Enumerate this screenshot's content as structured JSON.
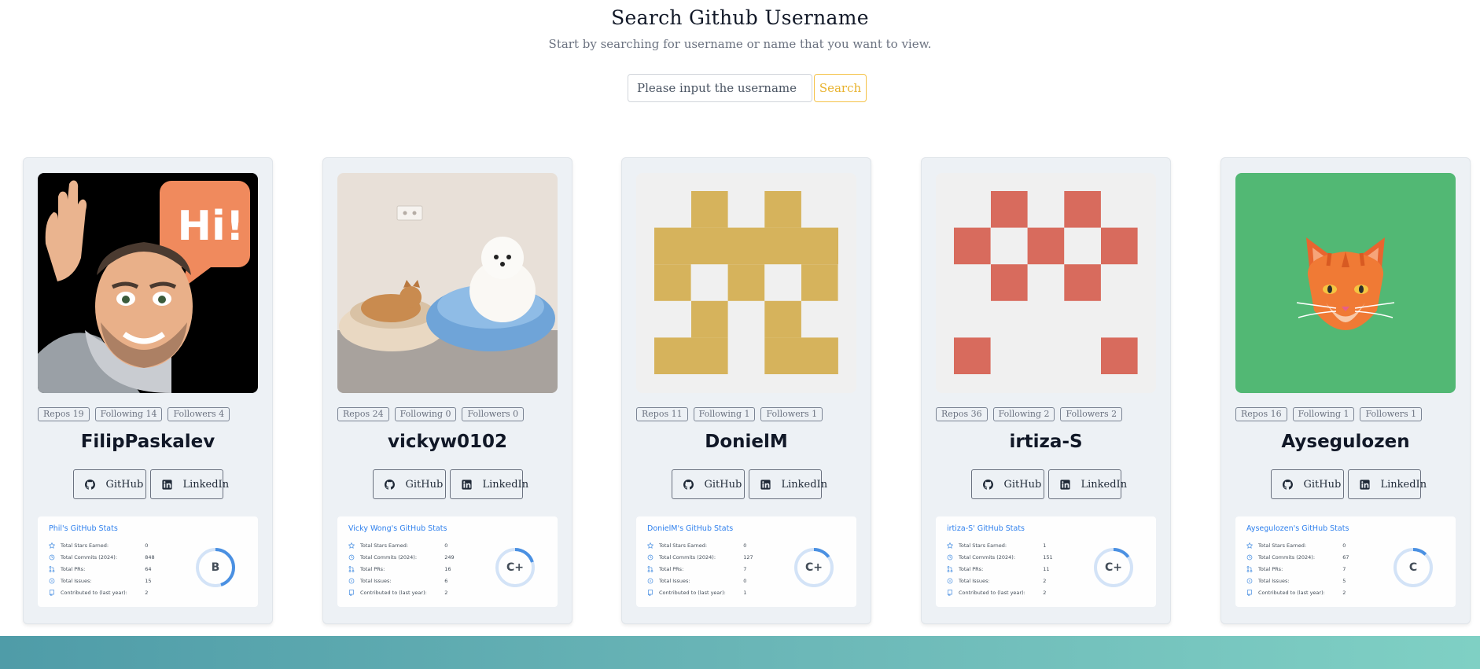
{
  "header": {
    "title": "Search Github Username",
    "subtitle": "Start by searching for username or name that you want to view."
  },
  "search": {
    "placeholder": "Please input the username",
    "button_label": "Search"
  },
  "link_labels": {
    "github": "GitHub",
    "linkedin": "LinkedIn"
  },
  "stat_labels": {
    "stars": "Total Stars Earned:",
    "commits": "Total Commits (2024):",
    "prs": "Total PRs:",
    "issues": "Total Issues:",
    "contributed": "Contributed to (last year):"
  },
  "colors": {
    "accent": "#f5c34a",
    "stats_title": "#2f80ed",
    "ring": "#4a90e2",
    "footer": "#5fb0b0"
  },
  "cards": [
    {
      "username": "FilipPaskalev",
      "repos": "Repos 19",
      "following": "Following 14",
      "followers": "Followers 4",
      "avatar": "memoji-hi-avatar",
      "stats": {
        "title": "Phil's GitHub Stats",
        "stars": "0",
        "commits": "848",
        "prs": "64",
        "issues": "15",
        "contributed": "2",
        "grade": "B",
        "rank_progress": 0.45
      }
    },
    {
      "username": "vickyw0102",
      "repos": "Repos 24",
      "following": "Following 0",
      "followers": "Followers 0",
      "avatar": "cat-and-dog-photo-avatar",
      "stats": {
        "title": "Vicky Wong's GitHub Stats",
        "stars": "0",
        "commits": "249",
        "prs": "16",
        "issues": "6",
        "contributed": "2",
        "grade": "C+",
        "rank_progress": 0.2
      }
    },
    {
      "username": "DonielM",
      "repos": "Repos 11",
      "following": "Following 1",
      "followers": "Followers 1",
      "avatar": "identicon-yellow",
      "stats": {
        "title": "DonielM's GitHub Stats",
        "stars": "0",
        "commits": "127",
        "prs": "7",
        "issues": "0",
        "contributed": "1",
        "grade": "C+",
        "rank_progress": 0.15
      }
    },
    {
      "username": "irtiza-S",
      "repos": "Repos 36",
      "following": "Following 2",
      "followers": "Followers 2",
      "avatar": "identicon-red",
      "stats": {
        "title": "irtiza-S' GitHub Stats",
        "stars": "1",
        "commits": "151",
        "prs": "11",
        "issues": "2",
        "contributed": "2",
        "grade": "C+",
        "rank_progress": 0.15
      }
    },
    {
      "username": "Aysegulozen",
      "repos": "Repos 16",
      "following": "Following 1",
      "followers": "Followers 1",
      "avatar": "orange-cat-avatar",
      "stats": {
        "title": "Aysegulozen's GitHub Stats",
        "stars": "0",
        "commits": "67",
        "prs": "7",
        "issues": "5",
        "contributed": "2",
        "grade": "C",
        "rank_progress": 0.12
      }
    }
  ]
}
